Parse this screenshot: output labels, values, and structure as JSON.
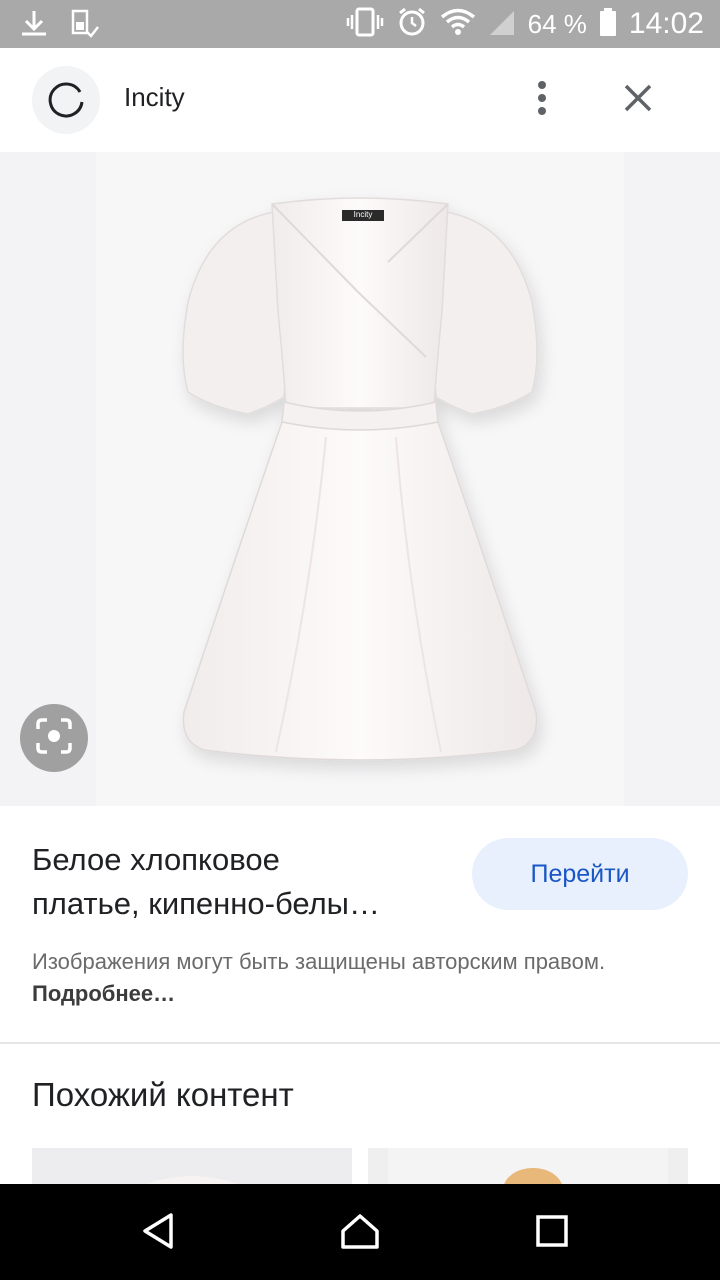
{
  "status_bar": {
    "battery": "64 %",
    "time": "14:02",
    "icons": [
      "download-icon",
      "sim-icon",
      "vibrate-icon",
      "alarm-icon",
      "wifi-icon",
      "signal-icon",
      "battery-icon"
    ]
  },
  "header": {
    "site_name": "Incity",
    "icons": [
      "site-logo-icon",
      "more-vertical-icon",
      "close-icon"
    ]
  },
  "image": {
    "label_text": "Incity",
    "lens_icon": "lens-icon"
  },
  "info": {
    "title_line1": "Белое хлопковое",
    "title_line2": "платье, кипенно-белы…",
    "goto_label": "Перейти",
    "copyright_text": "Изображения могут быть защищены авторским правом.",
    "copyright_link": "Подробнее…"
  },
  "similar": {
    "title": "Похожий контент"
  },
  "nav": {
    "icons": [
      "back-icon",
      "home-icon",
      "recents-icon"
    ]
  },
  "colors": {
    "status_bar": "#a9a9a9",
    "accent_button_bg": "#e8f0fe",
    "accent_text": "#1a56c4",
    "nav_bar": "#000000"
  }
}
